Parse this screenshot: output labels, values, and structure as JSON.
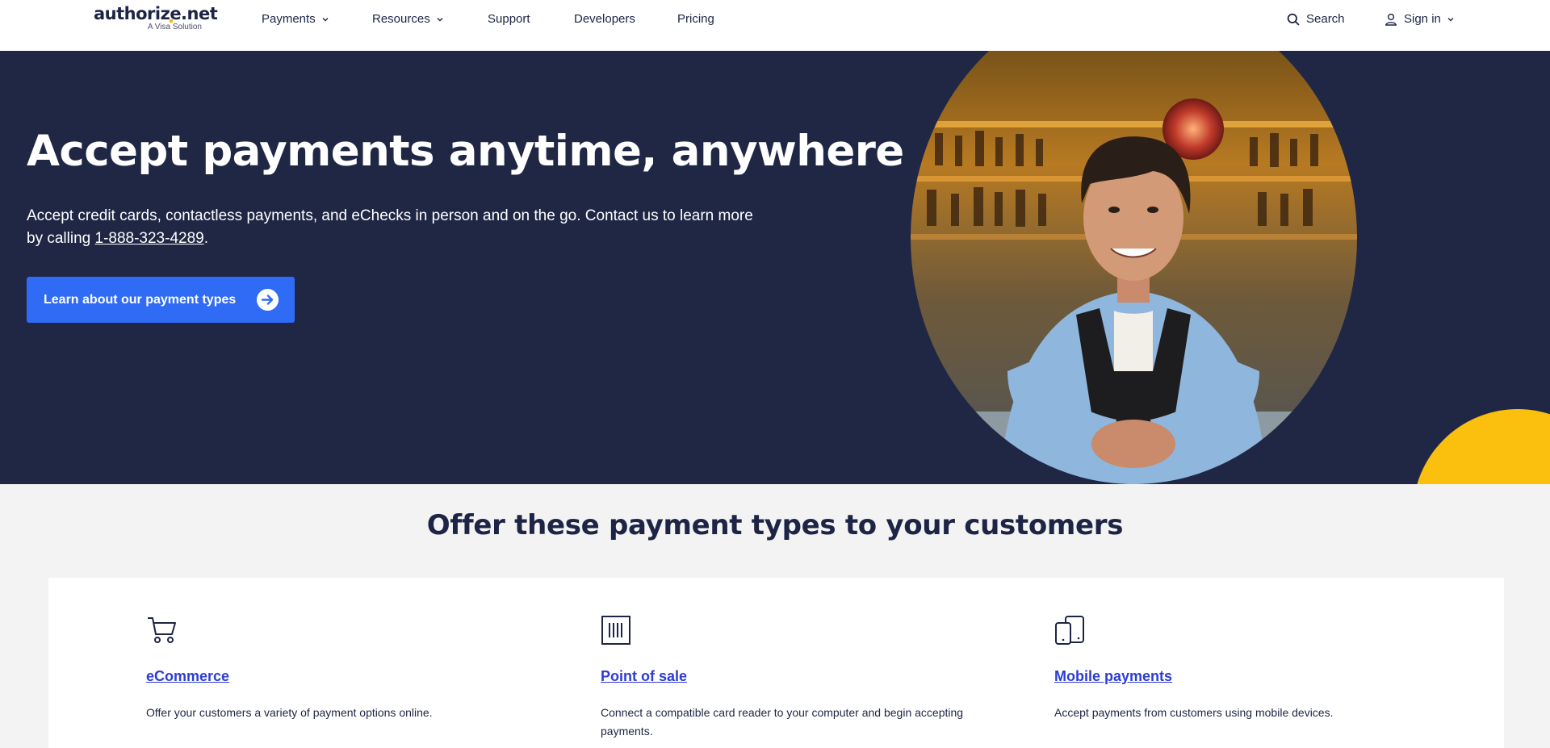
{
  "header": {
    "logo_text": "authorize.net",
    "logo_subtitle": "A Visa Solution",
    "nav": {
      "payments": "Payments",
      "resources": "Resources",
      "support": "Support",
      "developers": "Developers",
      "pricing": "Pricing",
      "search": "Search",
      "sign_in": "Sign in"
    },
    "icons": {
      "search": "search-icon",
      "user": "user-icon",
      "dropdown": "chevron-down-icon"
    }
  },
  "hero": {
    "title": "Accept payments anytime, anywhere",
    "text_before": "Accept credit cards, contactless payments, and eChecks in person and on the go. Contact us to learn more by calling ",
    "phone": "1-888-323-4289",
    "text_after": ".",
    "button_label": "Learn about our payment types",
    "button_icon": "arrow-right-circle-icon",
    "colors": {
      "background": "#1f2745",
      "button": "#2f6bf5",
      "accent": "#fbbf0e"
    }
  },
  "section": {
    "title": "Offer these payment types to your customers",
    "cards": [
      {
        "icon": "shopping-cart-icon",
        "title": "eCommerce",
        "description": "Offer your customers a variety of payment options online."
      },
      {
        "icon": "card-reader-icon",
        "title": "Point of sale",
        "description": "Connect a compatible card reader to your computer and begin accepting payments."
      },
      {
        "icon": "mobile-devices-icon",
        "title": "Mobile payments",
        "description": "Accept payments from customers using mobile devices."
      }
    ]
  }
}
